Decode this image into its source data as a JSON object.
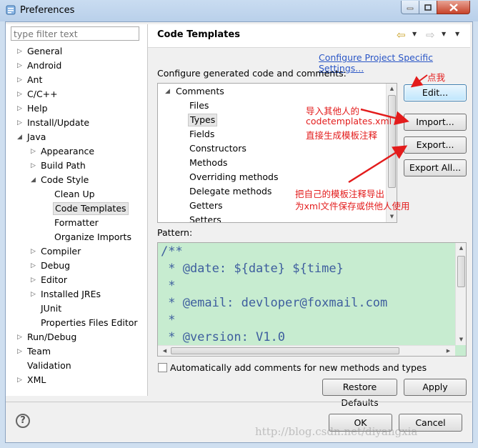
{
  "window": {
    "title": "Preferences"
  },
  "filter": {
    "placeholder": "type filter text"
  },
  "tree": [
    {
      "label": "General",
      "arrow": "▷"
    },
    {
      "label": "Android",
      "arrow": "▷"
    },
    {
      "label": "Ant",
      "arrow": "▷"
    },
    {
      "label": "C/C++",
      "arrow": "▷"
    },
    {
      "label": "Help",
      "arrow": "▷"
    },
    {
      "label": "Install/Update",
      "arrow": "▷"
    },
    {
      "label": "Java",
      "arrow": "◢"
    },
    {
      "label": "Appearance",
      "arrow": "▷"
    },
    {
      "label": "Build Path",
      "arrow": "▷"
    },
    {
      "label": "Code Style",
      "arrow": "◢"
    },
    {
      "label": "Clean Up",
      "arrow": ""
    },
    {
      "label": "Code Templates",
      "arrow": "",
      "selected": true
    },
    {
      "label": "Formatter",
      "arrow": ""
    },
    {
      "label": "Organize Imports",
      "arrow": ""
    },
    {
      "label": "Compiler",
      "arrow": "▷"
    },
    {
      "label": "Debug",
      "arrow": "▷"
    },
    {
      "label": "Editor",
      "arrow": "▷"
    },
    {
      "label": "Installed JREs",
      "arrow": "▷"
    },
    {
      "label": "JUnit",
      "arrow": ""
    },
    {
      "label": "Properties Files Editor",
      "arrow": ""
    },
    {
      "label": "Run/Debug",
      "arrow": "▷"
    },
    {
      "label": "Team",
      "arrow": "▷"
    },
    {
      "label": "Validation",
      "arrow": ""
    },
    {
      "label": "XML",
      "arrow": "▷"
    }
  ],
  "page": {
    "title": "Code Templates",
    "config_link": "Configure Project Specific Settings...",
    "config_label": "Configure generated code and comments:",
    "pattern_label": "Pattern:",
    "auto_comments": "Automatically add comments for new methods and types"
  },
  "templates": [
    {
      "label": "Comments",
      "arrow": "◢"
    },
    {
      "label": "Files"
    },
    {
      "label": "Types",
      "selected": true
    },
    {
      "label": "Fields"
    },
    {
      "label": "Constructors"
    },
    {
      "label": "Methods"
    },
    {
      "label": "Overriding methods"
    },
    {
      "label": "Delegate methods"
    },
    {
      "label": "Getters"
    },
    {
      "label": "Setters"
    }
  ],
  "buttons": {
    "edit": "Edit...",
    "import": "Import...",
    "export": "Export...",
    "export_all": "Export All...",
    "restore": "Restore Defaults",
    "apply": "Apply",
    "ok": "OK",
    "cancel": "Cancel"
  },
  "pattern_code": [
    "/**",
    " * @date: ${date} ${time}",
    " *",
    " * @email: devloper@foxmail.com",
    " *",
    " * @version: V1.0"
  ],
  "annotations": {
    "click": "点我",
    "import_line1": "导入其他人的",
    "import_line2": "codetemplates.xml",
    "import_line3": "直接生成模板注释",
    "export_line1": "把自己的模板注释导出",
    "export_line2": "为xml文件保存或供他人使用"
  },
  "watermark": "http://blog.csdn.net/diyangxia",
  "icons": {
    "title": "preferences-icon",
    "back": "back-arrow-icon",
    "forward": "forward-arrow-icon",
    "help": "help-icon"
  },
  "colors": {
    "link": "#2a56c6",
    "pattern_bg": "#c7ecd0",
    "code_text": "#3e5e9e",
    "annotation": "#e31c1c"
  }
}
